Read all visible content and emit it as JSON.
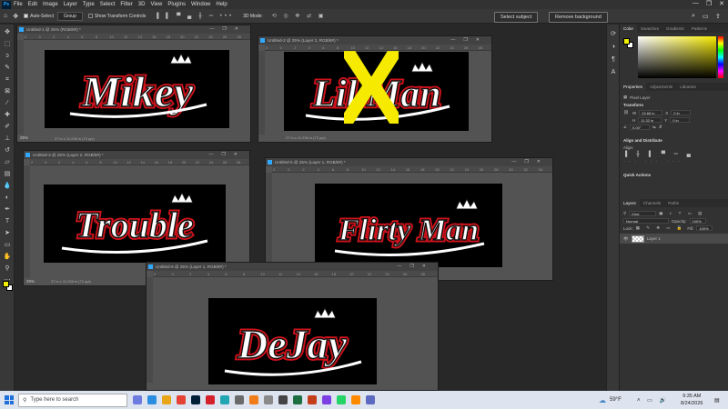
{
  "menubar": {
    "logo": "Ps",
    "items": [
      "File",
      "Edit",
      "Image",
      "Layer",
      "Type",
      "Select",
      "Filter",
      "3D",
      "View",
      "Plugins",
      "Window",
      "Help"
    ],
    "window_controls": [
      "—",
      "❐",
      "✕"
    ]
  },
  "options_bar": {
    "auto_select_label": "Auto-Select",
    "auto_select_checked": true,
    "auto_select_target": "Group",
    "transform_controls_label": "Show Transform Controls",
    "transform_controls_checked": false,
    "mode_3d_label": "3D Mode:",
    "select_subject": "Select subject",
    "remove_background": "Remove background"
  },
  "toolbar": {
    "tools": [
      "move-icon",
      "marquee-icon",
      "lasso-icon",
      "quick-select-icon",
      "crop-icon",
      "frame-icon",
      "eyedropper-icon",
      "healing-icon",
      "brush-icon",
      "stamp-icon",
      "history-brush-icon",
      "eraser-icon",
      "gradient-icon",
      "blur-icon",
      "dodge-icon",
      "pen-icon",
      "type-icon",
      "path-select-icon",
      "shape-icon",
      "hand-icon",
      "zoom-icon",
      "more-icon"
    ],
    "foreground_color": "#f0f000",
    "background_color": "#ffffff"
  },
  "documents": [
    {
      "title": "Untitled-1 @ 25% (RGB/8#) *",
      "zoom": "25%",
      "info": "27 in x 11.236 in (72 ppi)",
      "logo_text": "Mikey",
      "rulers": [
        "2",
        "0",
        "2",
        "4",
        "6",
        "8",
        "10",
        "12",
        "14",
        "16",
        "18",
        "20",
        "22",
        "24",
        "26",
        "28"
      ]
    },
    {
      "title": "Untitled-2 @ 25% (Layer 2, RGB/8#) *",
      "zoom": "",
      "info": "27 in x 11.236 in (72 ppi)",
      "logo_text": "Lil Man",
      "rulers": [
        "2",
        "0",
        "2",
        "4",
        "6",
        "8",
        "10",
        "12",
        "14",
        "16",
        "18",
        "20",
        "22",
        "24",
        "26",
        "28"
      ]
    },
    {
      "title": "Untitled-3 @ 25% (Layer 2, RGB/8#) *",
      "zoom": "25%",
      "info": "27 in x 11.236 in (72 ppi)",
      "logo_text": "Trouble",
      "rulers": [
        "2",
        "0",
        "2",
        "4",
        "6",
        "8",
        "10",
        "12",
        "14",
        "16",
        "18",
        "20",
        "22",
        "24",
        "26",
        "28"
      ]
    },
    {
      "title": "Untitled-5 @ 25% (Layer 1, RGB/8#) *",
      "zoom": "",
      "info": "",
      "logo_text": "Flirty Man",
      "rulers": [
        "2",
        "0",
        "2",
        "4",
        "6",
        "8",
        "10",
        "12",
        "14",
        "16",
        "18",
        "20",
        "22",
        "24",
        "26",
        "28",
        "30",
        "32",
        "34"
      ]
    },
    {
      "title": "Untitled-6 @ 25% (Layer 1, RGB/8#) *",
      "zoom": "",
      "info": "",
      "logo_text": "DeJay",
      "rulers": [
        "2",
        "0",
        "2",
        "4",
        "6",
        "8",
        "10",
        "12",
        "14",
        "16",
        "18",
        "20",
        "22",
        "24",
        "26",
        "28"
      ]
    }
  ],
  "overlay_mark": "X",
  "colors": {
    "accent_yellow": "#f5ea00",
    "logo_red": "#d0121b",
    "app_bg": "#282828"
  },
  "right_panel": {
    "color_tabs": [
      "Color",
      "Swatches",
      "Gradients",
      "Patterns"
    ],
    "prop_tabs": [
      "Properties",
      "Adjustments",
      "Libraries"
    ],
    "pixel_layer": "Pixel Layer",
    "transform_title": "Transform",
    "w_label": "W",
    "w_value": "24.66 in",
    "h_label": "H",
    "h_value": "11.32 in",
    "x_label": "X",
    "x_value": "0 in",
    "y_label": "Y",
    "y_value": "0 in",
    "angle_value": "0.00°",
    "align_title": "Align and Distribute",
    "align_label": "Align:",
    "quick_actions": "Quick Actions",
    "layer_tabs": [
      "Layers",
      "Channels",
      "Paths"
    ],
    "kind_label": "Kind",
    "blend_mode": "Normal",
    "opacity_label": "Opacity:",
    "opacity_value": "100%",
    "lock_label": "Lock:",
    "fill_label": "Fill:",
    "fill_value": "100%",
    "layer_name": "Layer 1"
  },
  "taskbar": {
    "search_placeholder": "Type here to search",
    "weather": "59°F",
    "time": "9:35 AM",
    "date": "8/24/2026"
  }
}
